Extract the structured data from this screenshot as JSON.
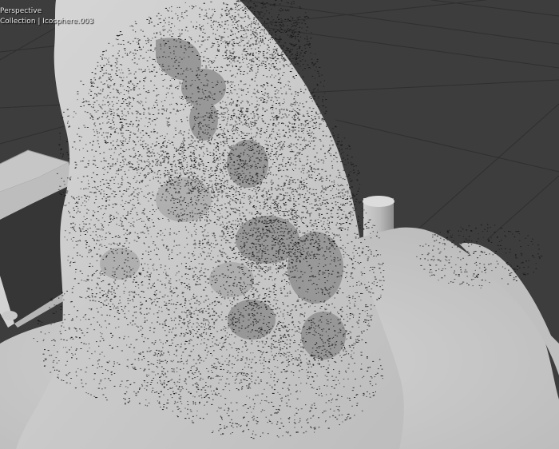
{
  "viewport": {
    "view_mode": "Perspective",
    "object_info": "Collection | Icosphere.003",
    "background_color": "#3d3d3d",
    "grid_color": "#2e2e2e",
    "mesh_color": "#c9c9c9",
    "shadow_color": "#8a8a8a",
    "particle_color": "#141414"
  }
}
